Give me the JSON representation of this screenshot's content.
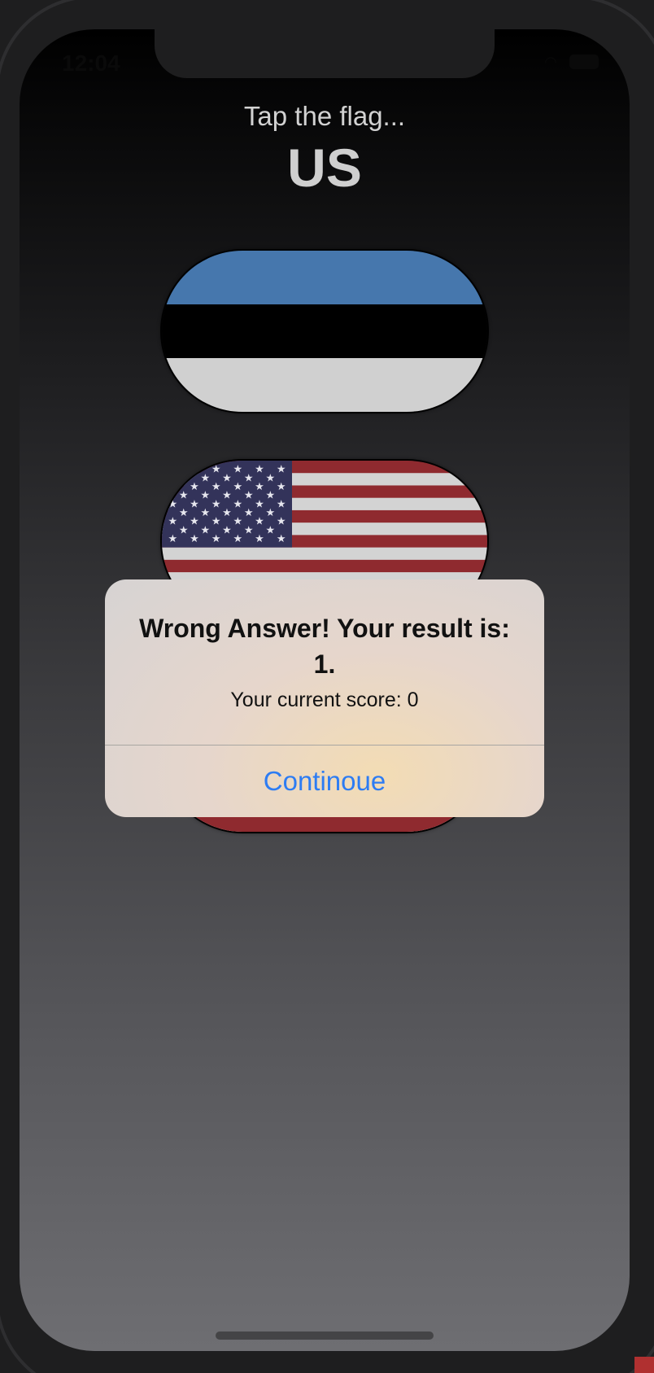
{
  "status_bar": {
    "time": "12:04",
    "wifi_icon": "wifi-icon",
    "battery_icon": "battery-icon"
  },
  "header": {
    "prompt": "Tap the flag...",
    "country": "US"
  },
  "flags": [
    {
      "name": "Estonia",
      "icon": "estonia-flag-icon"
    },
    {
      "name": "US",
      "icon": "us-flag-icon"
    },
    {
      "name": "Unknown",
      "icon": "flag-icon"
    }
  ],
  "alert": {
    "title": "Wrong Answer! Your result is: 1.",
    "message": "Your current score: 0",
    "action_label": "Continoue",
    "action_color": "#2d7cf3"
  },
  "colors": {
    "estonia_blue": "#4677ad",
    "estonia_black": "#000000",
    "estonia_white": "#d0d0d0",
    "us_red": "#8f2a2f",
    "us_white": "#d3d3d3",
    "us_blue": "#33335a"
  }
}
